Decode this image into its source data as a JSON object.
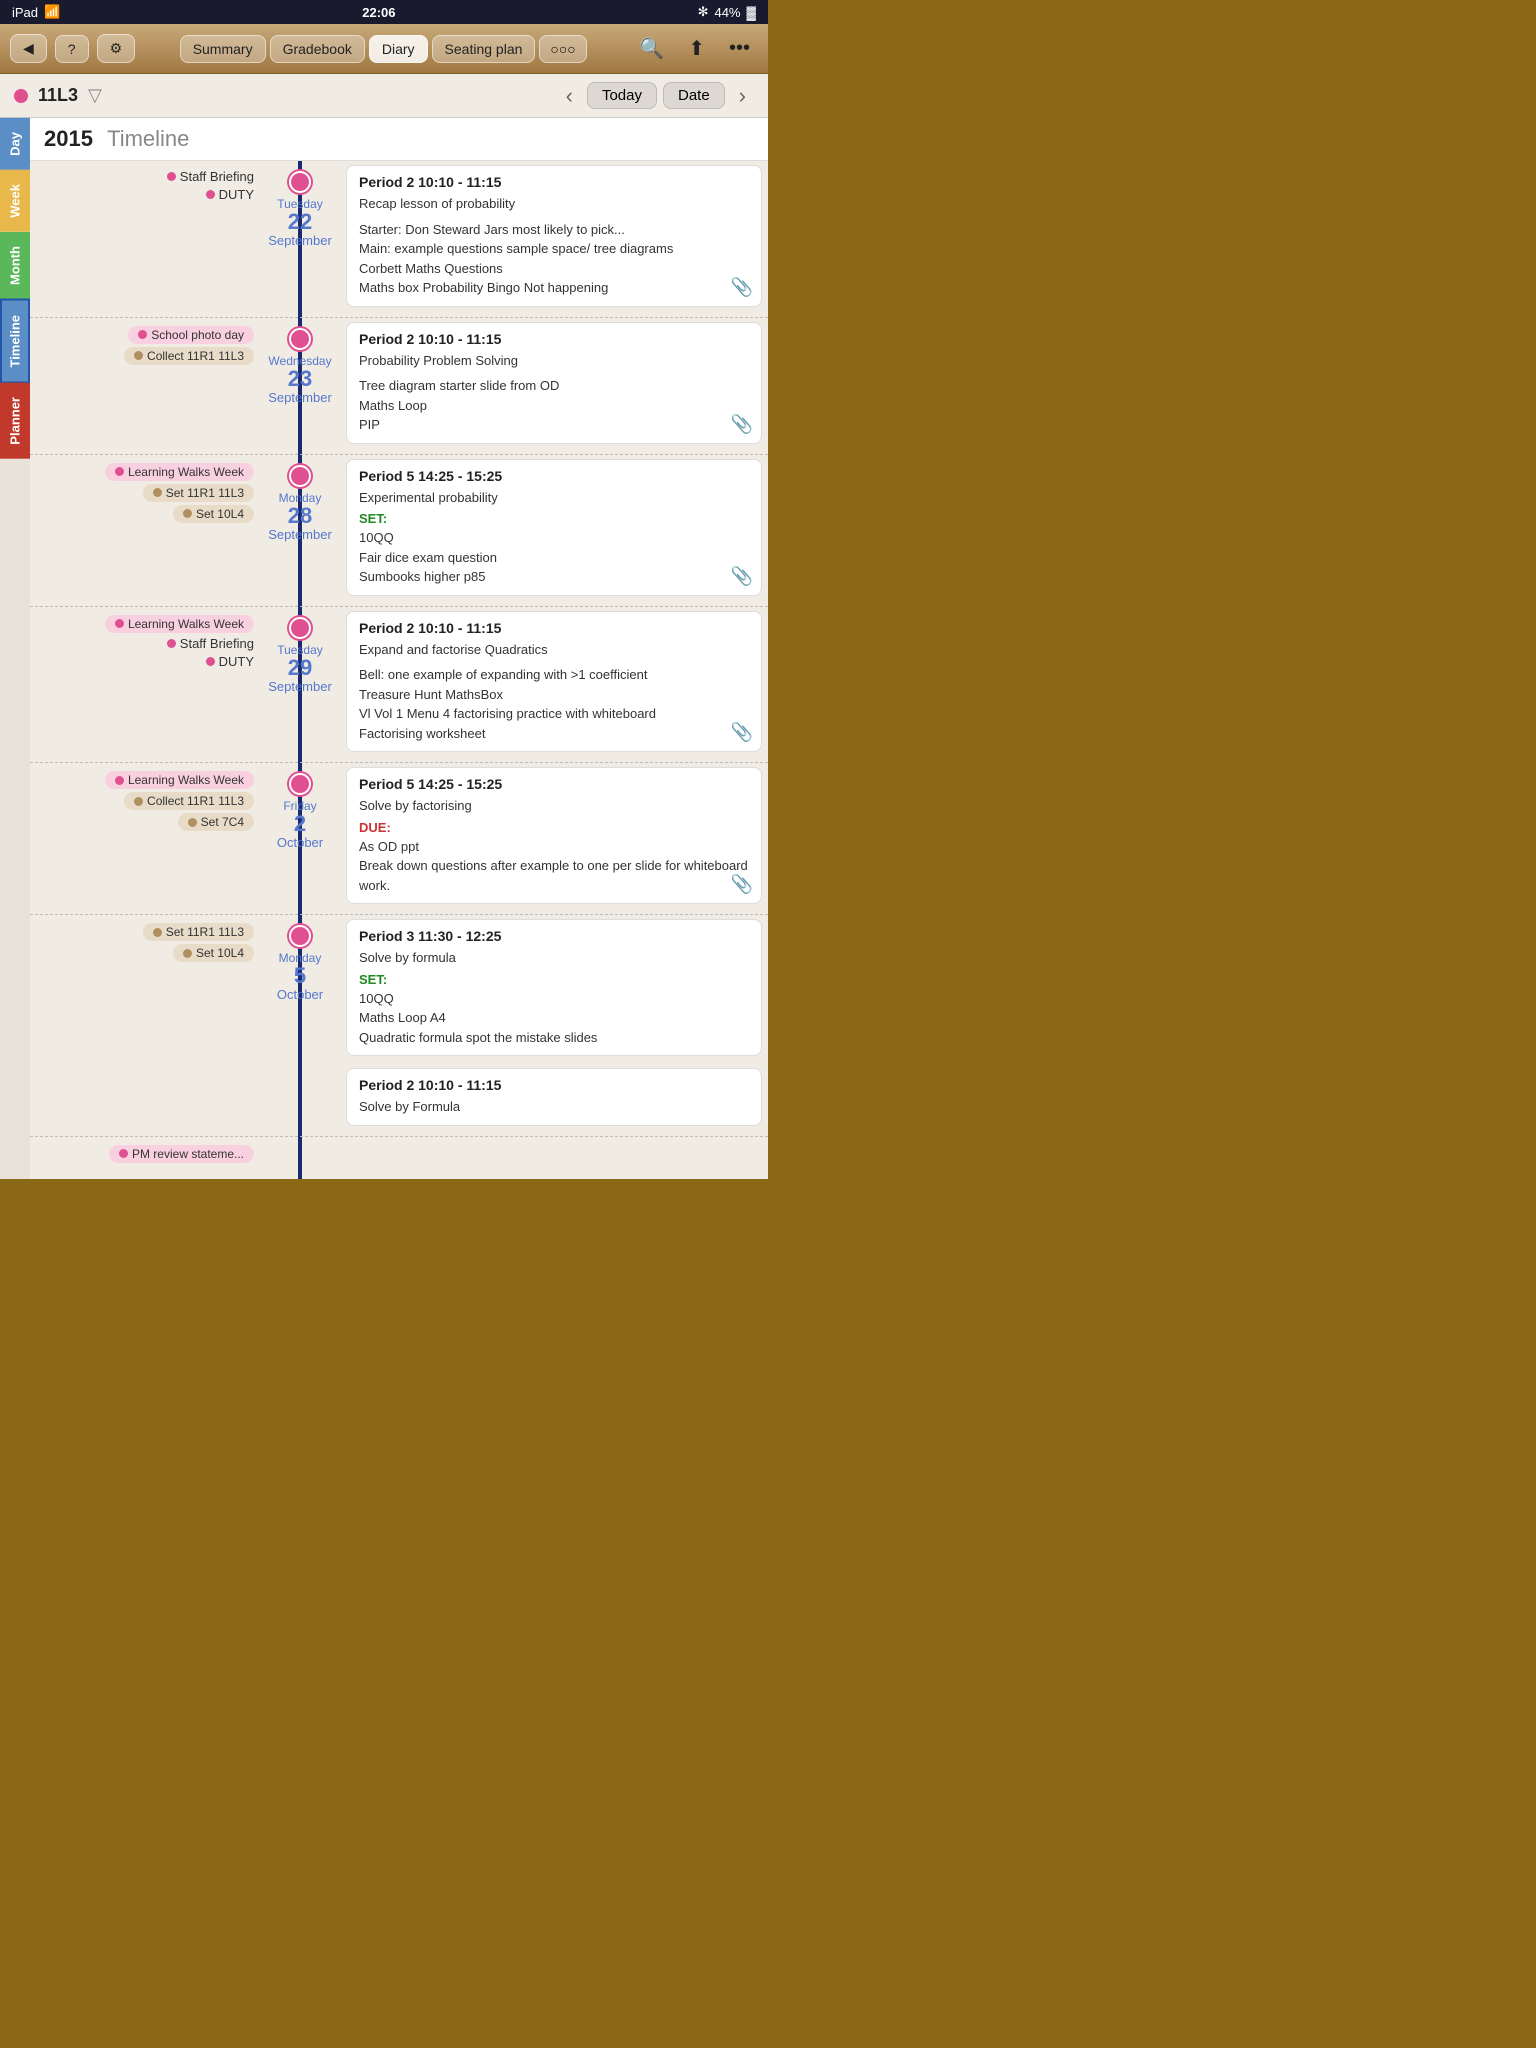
{
  "statusBar": {
    "left": "iPad",
    "wifi": "wifi",
    "time": "22:06",
    "bluetooth": "bluetooth",
    "battery": "44%"
  },
  "navBar": {
    "backBtn": "◀",
    "helpBtn": "?",
    "settingsBtn": "🔧",
    "tabs": [
      "Summary",
      "Gradebook",
      "Diary",
      "Seating plan",
      "○○○"
    ],
    "activeTab": "Diary",
    "searchBtn": "🔍",
    "shareBtn": "⬆",
    "moreBtn": "•••"
  },
  "classBar": {
    "className": "11L3",
    "prevBtn": "‹",
    "todayBtn": "Today",
    "dateBtn": "Date",
    "nextBtn": "›"
  },
  "yearHeader": {
    "year": "2015",
    "label": "Timeline"
  },
  "sideTabs": [
    "Day",
    "Week",
    "Month",
    "Timeline",
    "Planner"
  ],
  "sections": [
    {
      "dayName": "Tuesday",
      "dayNum": "22",
      "month": "September",
      "leftEvents": [
        {
          "type": "plain",
          "dotColor": "pink",
          "text": "Staff Briefing"
        },
        {
          "type": "plain",
          "dotColor": "pink",
          "text": "DUTY"
        }
      ],
      "entries": [
        {
          "title": "Period 2    10:10 - 11:15",
          "subtitle": "Recap lesson of probability",
          "body": "Starter: Don Steward Jars most likely to pick...\nMain: example questions sample space/ tree diagrams\nCorbett Maths Questions\nMaths box Probability Bingo Not happening",
          "label": "",
          "hasClip": true
        }
      ]
    },
    {
      "dayName": "Wednesday",
      "dayNum": "23",
      "month": "September",
      "leftEvents": [
        {
          "type": "tag",
          "color": "pink",
          "text": "School photo day"
        },
        {
          "type": "tag",
          "color": "tan",
          "text": "Collect 11R1 11L3"
        }
      ],
      "entries": [
        {
          "title": "Period 2    10:10 - 11:15",
          "subtitle": "Probability Problem Solving",
          "body": "Tree diagram starter slide from OD\nMaths Loop\nPIP",
          "label": "",
          "hasClip": true
        }
      ]
    },
    {
      "dayName": "Monday",
      "dayNum": "28",
      "month": "September",
      "leftEvents": [
        {
          "type": "tag",
          "color": "pink",
          "text": "Learning Walks Week"
        },
        {
          "type": "tag",
          "color": "tan",
          "text": "Set 11R1 11L3"
        },
        {
          "type": "tag",
          "color": "tan",
          "text": "Set 10L4"
        }
      ],
      "entries": [
        {
          "title": "Period 5    14:25 - 15:25",
          "subtitle": "Experimental probability",
          "body": "10QQ\nFair dice exam question\nSumbooks higher p85",
          "label": "SET:",
          "labelType": "set",
          "hasClip": true
        }
      ]
    },
    {
      "dayName": "Tuesday",
      "dayNum": "29",
      "month": "September",
      "leftEvents": [
        {
          "type": "tag",
          "color": "pink",
          "text": "Learning Walks Week"
        },
        {
          "type": "plain",
          "dotColor": "pink",
          "text": "Staff Briefing"
        },
        {
          "type": "plain",
          "dotColor": "pink",
          "text": "DUTY"
        }
      ],
      "entries": [
        {
          "title": "Period 2    10:10 - 11:15",
          "subtitle": "Expand and factorise Quadratics",
          "body": "Bell: one example of expanding with >1 coefficient\nTreasure Hunt MathsBox\nVl Vol 1 Menu 4 factorising practice with whiteboard\nFactorising worksheet",
          "label": "",
          "hasClip": true
        }
      ]
    },
    {
      "dayName": "Friday",
      "dayNum": "2",
      "month": "October",
      "leftEvents": [
        {
          "type": "tag",
          "color": "pink",
          "text": "Learning Walks Week"
        },
        {
          "type": "tag",
          "color": "tan",
          "text": "Collect 11R1 11L3"
        },
        {
          "type": "tag",
          "color": "tan",
          "text": "Set 7C4"
        }
      ],
      "entries": [
        {
          "title": "Period 5    14:25 - 15:25",
          "subtitle": "Solve by factorising",
          "body": "As OD ppt\nBreak down questions after example to one per slide for whiteboard work.",
          "label": "DUE:",
          "labelType": "due",
          "hasClip": true
        }
      ]
    },
    {
      "dayName": "Monday",
      "dayNum": "5",
      "month": "October",
      "leftEvents": [
        {
          "type": "tag",
          "color": "tan",
          "text": "Set 11R1 11L3"
        },
        {
          "type": "tag",
          "color": "tan",
          "text": "Set 10L4"
        }
      ],
      "entries": [
        {
          "title": "Period 3    11:30 - 12:25",
          "subtitle": "Solve by formula",
          "body": "10QQ\nMaths Loop A4\nQuadratic formula spot the mistake slides",
          "label": "SET:",
          "labelType": "set",
          "hasClip": false
        },
        {
          "title": "Period 2    10:10 - 11:15",
          "subtitle": "Solve by Formula",
          "body": "",
          "label": "",
          "hasClip": false
        }
      ]
    }
  ],
  "bottomPartial": {
    "leftEvents": [
      {
        "type": "tag",
        "color": "pink",
        "text": "PM review stateme..."
      }
    ]
  }
}
